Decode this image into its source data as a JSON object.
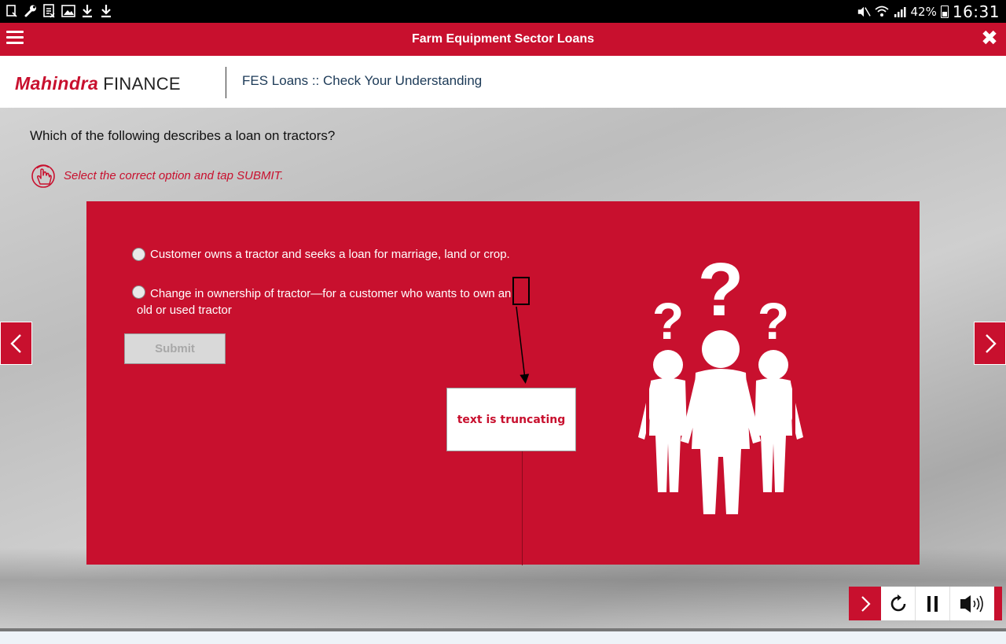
{
  "status_bar": {
    "left_icons": [
      "file-icon",
      "wrench-icon",
      "document-icon",
      "image-icon",
      "download-icon",
      "download-icon"
    ],
    "right_icons": [
      "mute-icon",
      "wifi-icon",
      "signal-icon",
      "battery-icon"
    ],
    "battery_text": "42%",
    "time": "16:31"
  },
  "title_bar": {
    "title": "Farm Equipment Sector Loans",
    "menu_icon": "hamburger-menu-icon",
    "close_icon": "close-icon"
  },
  "header": {
    "logo_brand": "Mahindra",
    "logo_word": "FINANCE",
    "course_title": "FES Loans :: Check Your Understanding"
  },
  "quiz": {
    "question": "Which of the following describes a loan on tractors?",
    "instruction_icon": "hand-tap-icon",
    "instruction": "Select the correct option and tap SUBMIT.",
    "options": [
      {
        "label": "Customer owns a tractor and seeks a loan for marriage, land or crop.",
        "selected": false
      },
      {
        "label_line1": "Change in ownership of tractor—for a customer who wants to own an",
        "label_line2": "old or used tractor",
        "selected": false
      }
    ],
    "submit_label": "Submit",
    "illustration": "people-with-question-marks-illustration"
  },
  "annotation": {
    "note": "text is truncating"
  },
  "navigation": {
    "prev_icon": "chevron-left-icon",
    "next_icon": "chevron-right-icon"
  },
  "controls": {
    "next_icon": "chevron-right-icon",
    "replay_icon": "replay-icon",
    "pause_icon": "pause-icon",
    "audio_icon": "volume-icon"
  },
  "colors": {
    "brand_red": "#c8102e",
    "title_bar": "#c8102e",
    "status_bar": "#000000",
    "submit_disabled": "#d9d9d9"
  }
}
